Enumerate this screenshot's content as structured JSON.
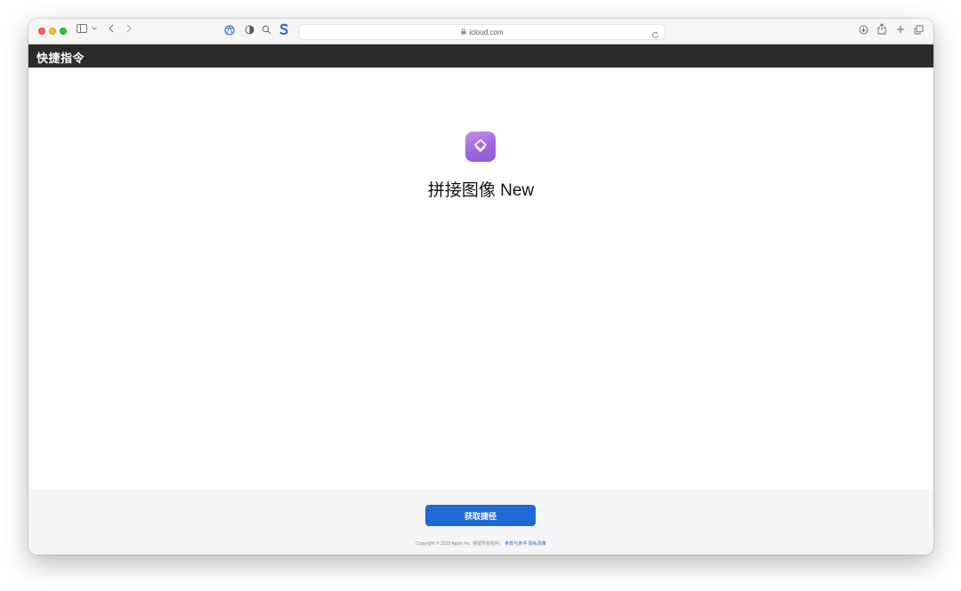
{
  "browser": {
    "url": "icloud.com",
    "icons": [
      "sidebar-icon",
      "chevron-down-icon",
      "back-icon",
      "forward-icon",
      "extension-icon",
      "contrast-icon",
      "search-icon",
      "s-extension-icon",
      "lock-icon",
      "reload-icon",
      "download-icon",
      "share-icon",
      "new-tab-icon",
      "tabs-overview-icon"
    ]
  },
  "app": {
    "title": "快捷指令"
  },
  "shortcut": {
    "name": "拼接图像 New",
    "icon": "shortcuts-layers-icon",
    "icon_color": "#a066e0"
  },
  "footer": {
    "get_button_label": "获取捷径",
    "copyright_text": "Copyright © 2023 Apple Inc. 保留所有权利。",
    "terms_label": "条款与条件",
    "privacy_label": "隐私政策",
    "button_color": "#1f6ad6"
  }
}
